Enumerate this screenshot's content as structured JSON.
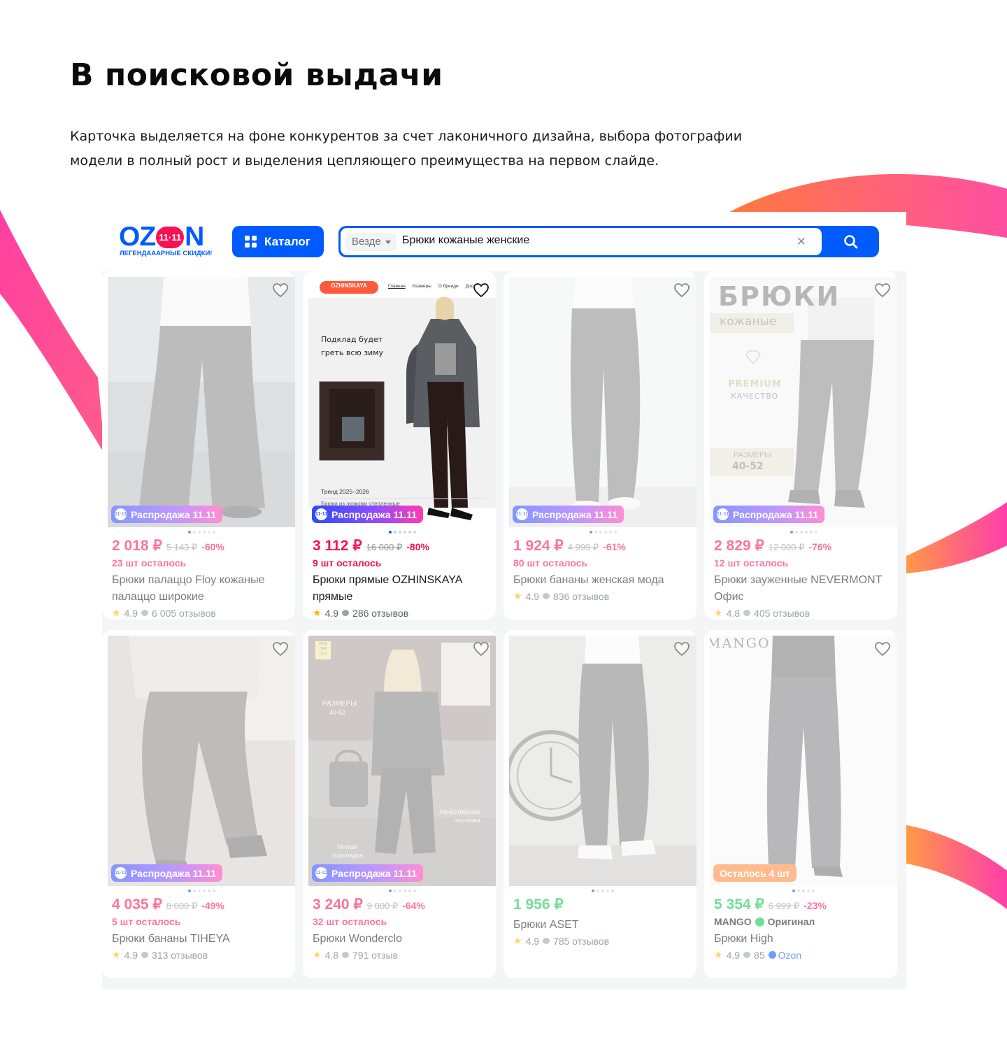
{
  "heading": "В поисковой выдачи",
  "description": "Карточка выделяется на фоне конкурентов за счет лаконичного дизайна, выбора фотографии модели в полный рост и выделения цепляющего преимущества на первом слайде.",
  "colors": {
    "accent": "#005bff",
    "sale": "#f91155",
    "green": "#10c44c",
    "ribbon_start": "#ff4fa3",
    "ribbon_end": "#ff8a3d"
  },
  "header": {
    "logo": {
      "word_left": "OZ",
      "word_badge": "11·11",
      "word_right": "N",
      "tagline": "ЛЕГЕНДАААРНЫЕ СКИДКИ!"
    },
    "catalog_label": "Каталог",
    "search": {
      "scope": "Везде",
      "query": "Брюки кожаные женские",
      "clear_icon": "close-icon",
      "button_icon": "search-icon"
    }
  },
  "products": [
    {
      "price": "2 018 ₽",
      "old_price": "5 143 ₽",
      "discount": "-60%",
      "stock": "23 шт осталось",
      "name": "Брюки палаццо Floy кожаные палаццо широкие",
      "rating": "4.9",
      "reviews": "6 005 отзывов",
      "badge": "Распродажа 11.11",
      "photo": "wide-leg"
    },
    {
      "price": "3 112 ₽",
      "old_price": "16 000 ₽",
      "discount": "-80%",
      "stock": "9 шт осталось",
      "name": "Брюки прямые OZHINSKAYA прямые",
      "rating": "4.9",
      "reviews": "286 отзывов",
      "badge": "Распродажа 11.11",
      "photo": "promo",
      "promo": {
        "brand": "OZHINSKAYA",
        "nav": [
          "Главная",
          "Размеры",
          "О бренде",
          "Дост"
        ],
        "caption": "Подклад будет греть всю зиму",
        "trend": "Тренд 2025–2026",
        "footnote": "Брюки из экокожи утепленные"
      }
    },
    {
      "price": "1 924 ₽",
      "old_price": "4 999 ₽",
      "discount": "-61%",
      "stock": "80 шт осталось",
      "name": "Брюки бананы женская мода",
      "rating": "4.9",
      "reviews": "836 отзывов",
      "badge": "Распродажа 11.11",
      "photo": "straight"
    },
    {
      "price": "2 829 ₽",
      "old_price": "12 000 ₽",
      "discount": "-76%",
      "stock": "12 шт осталось",
      "name": "Брюки зауженные NEVERMONT Офис",
      "rating": "4.8",
      "reviews": "405 отзывов",
      "badge": "Распродажа 11.11",
      "photo": "banner",
      "banner": {
        "big": "БРЮКИ",
        "tag": "кожаные",
        "premium": "PREMIUM",
        "quality": "КАЧЕСТВО",
        "sizes_label": "РАЗМЕРЫ",
        "sizes": "40-52"
      }
    },
    {
      "price": "4 035 ₽",
      "old_price": "8 000 ₽",
      "discount": "-49%",
      "stock": "5 шт осталось",
      "name": "Брюки бананы TIHEYA",
      "rating": "4.9",
      "reviews": "313 отзывов",
      "badge": "Распродажа 11.11",
      "photo": "sweater"
    },
    {
      "price": "3 240 ₽",
      "old_price": "9 000 ₽",
      "discount": "-64%",
      "stock": "32 шт осталось",
      "name": "Брюки Wonderclo",
      "rating": "4.8",
      "reviews": "791 отзыв",
      "badge": "Распродажа 11.11",
      "photo": "street",
      "street": {
        "logo": "WON DER CLO",
        "sizes_label": "РАЗМЕРЫ",
        "sizes": "40-52",
        "quality_1": "Качественная",
        "quality_2": "эко-кожа",
        "lining_1": "Мягкая",
        "lining_2": "подкладка"
      }
    },
    {
      "price": "1 956 ₽",
      "name": "Брюки ASET",
      "rating": "4.9",
      "reviews": "785 отзывов",
      "photo": "clock"
    },
    {
      "price": "5 354 ₽",
      "old_price": "6 999 ₽",
      "discount": "-23%",
      "brand": "MANGO",
      "original": "Оригинал",
      "name": "Брюки High",
      "rating": "4.9",
      "reviews": "85",
      "seller": "Ozon",
      "badge": "Осталось 4 шт",
      "photo": "mango",
      "mango": {
        "logo": "MANGO"
      }
    }
  ]
}
